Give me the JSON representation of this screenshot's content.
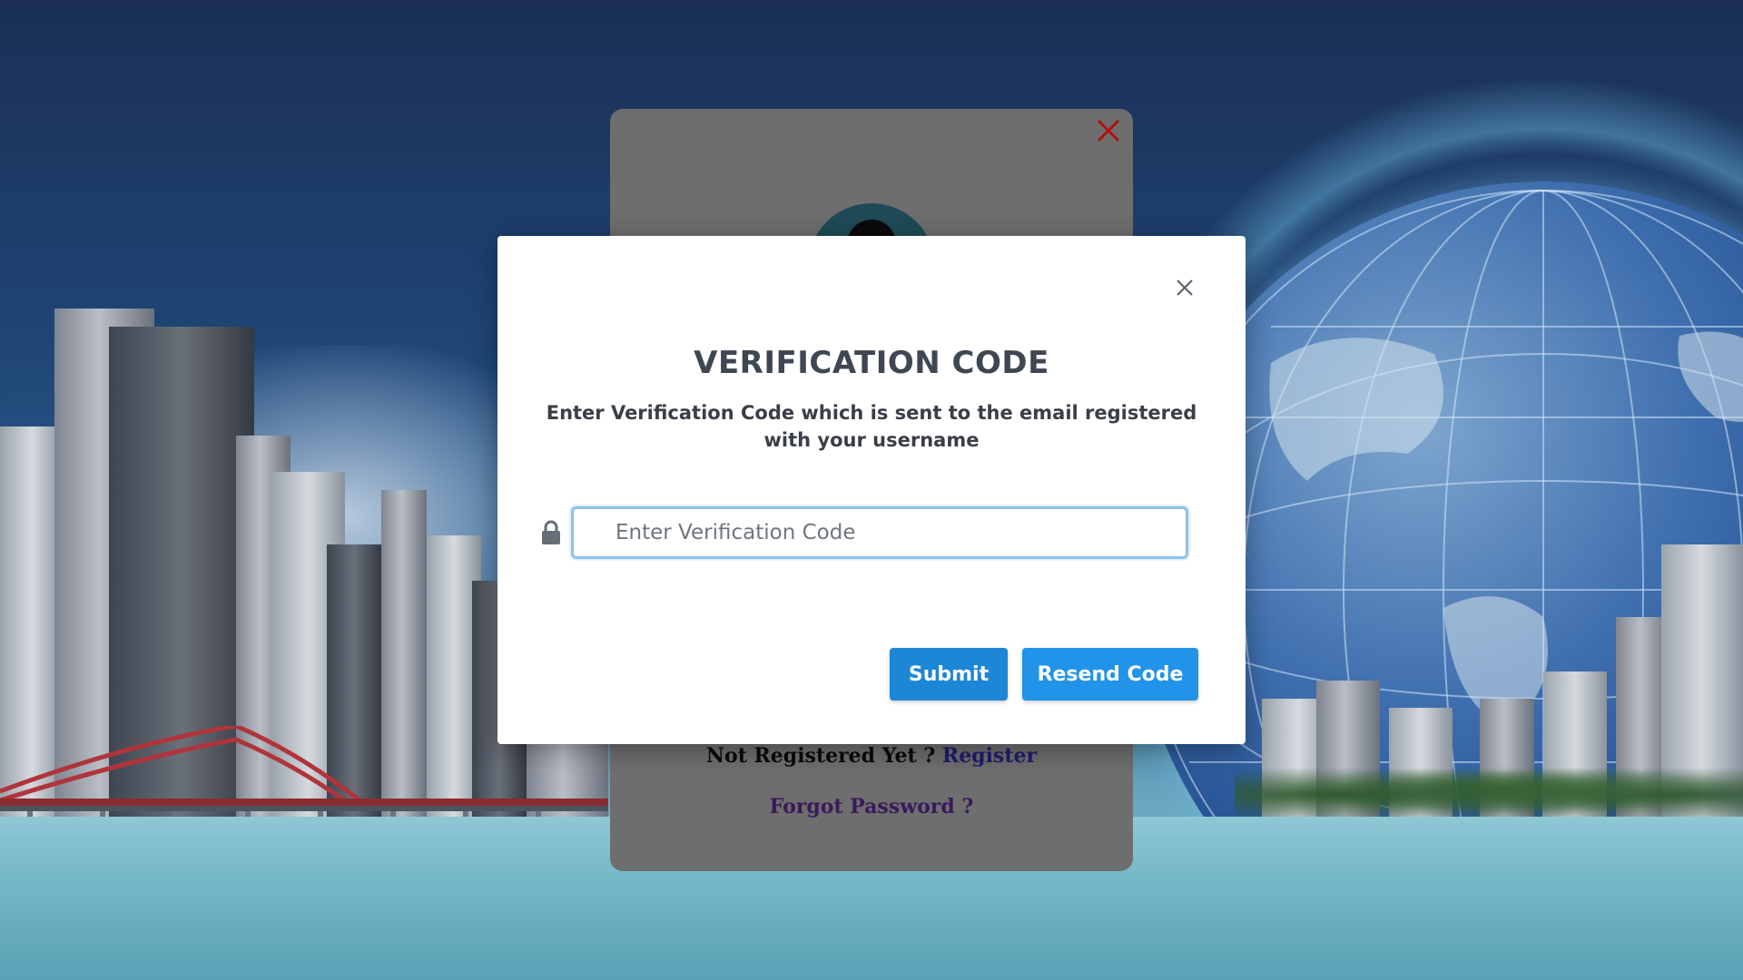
{
  "login_card": {
    "not_registered_text": "Not Registered Yet ?",
    "register_link": "Register",
    "forgot_password": "Forgot Password ?",
    "close_icon": "close-icon",
    "close_color": "#b01010"
  },
  "modal": {
    "title": "VERIFICATION CODE",
    "description": "Enter Verification Code which is sent to the email registered with your username",
    "input_placeholder": "Enter Verification Code",
    "input_value": "",
    "lock_icon": "lock-icon",
    "close_icon": "close-icon",
    "submit_label": "Submit",
    "resend_label": "Resend Code",
    "accent_color": "#2193e8"
  }
}
